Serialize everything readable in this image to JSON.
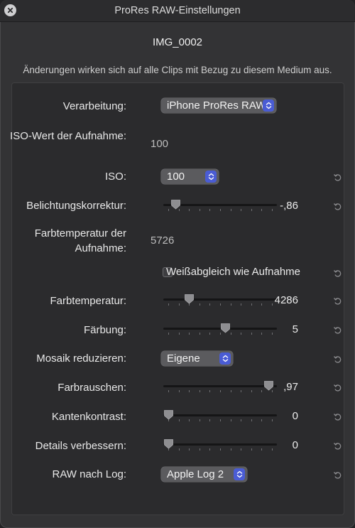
{
  "window": {
    "title": "ProRes RAW-Einstellungen"
  },
  "clip_name": "IMG_0002",
  "info_text": "Änderungen wirken sich auf alle Clips mit Bezug zu diesem Medium aus.",
  "rows": {
    "verarbeitung": {
      "label": "Verarbeitung:",
      "value": "iPhone ProRes RAW"
    },
    "iso_aufnahme": {
      "label": "ISO-Wert der Aufnahme:",
      "value": "100"
    },
    "iso": {
      "label": "ISO:",
      "value": "100"
    },
    "belichtung": {
      "label": "Belichtungskorrektur:",
      "value": "-,86",
      "level": 0.07
    },
    "farbtemp_aufnahme": {
      "label": "Farbtemperatur der Aufnahme:",
      "value": "5726"
    },
    "weissabgleich": {
      "label": "Weißabgleich wie Aufnahme",
      "checked": false
    },
    "farbtemperatur": {
      "label": "Farbtemperatur:",
      "value": "4286",
      "level": 0.2
    },
    "faerbung": {
      "label": "Färbung:",
      "value": "5",
      "level": 0.55
    },
    "mosaik": {
      "label": "Mosaik reduzieren:",
      "value": "Eigene"
    },
    "farbrauschen": {
      "label": "Farbrauschen:",
      "value": ",97",
      "level": 0.97
    },
    "kantenkontrast": {
      "label": "Kantenkontrast:",
      "value": "0",
      "level": 0
    },
    "details": {
      "label": "Details verbessern:",
      "value": "0",
      "level": 0
    },
    "raw_log": {
      "label": "RAW nach Log:",
      "value": "Apple Log 2"
    }
  },
  "icons": {
    "close": "close-icon",
    "reset": "reset-arrow-icon",
    "stepper": "up-down-chevron-icon"
  },
  "colors": {
    "accent": "#4a5cd4",
    "window_bg": "#333335",
    "panel_bg": "#2b2b2d"
  }
}
